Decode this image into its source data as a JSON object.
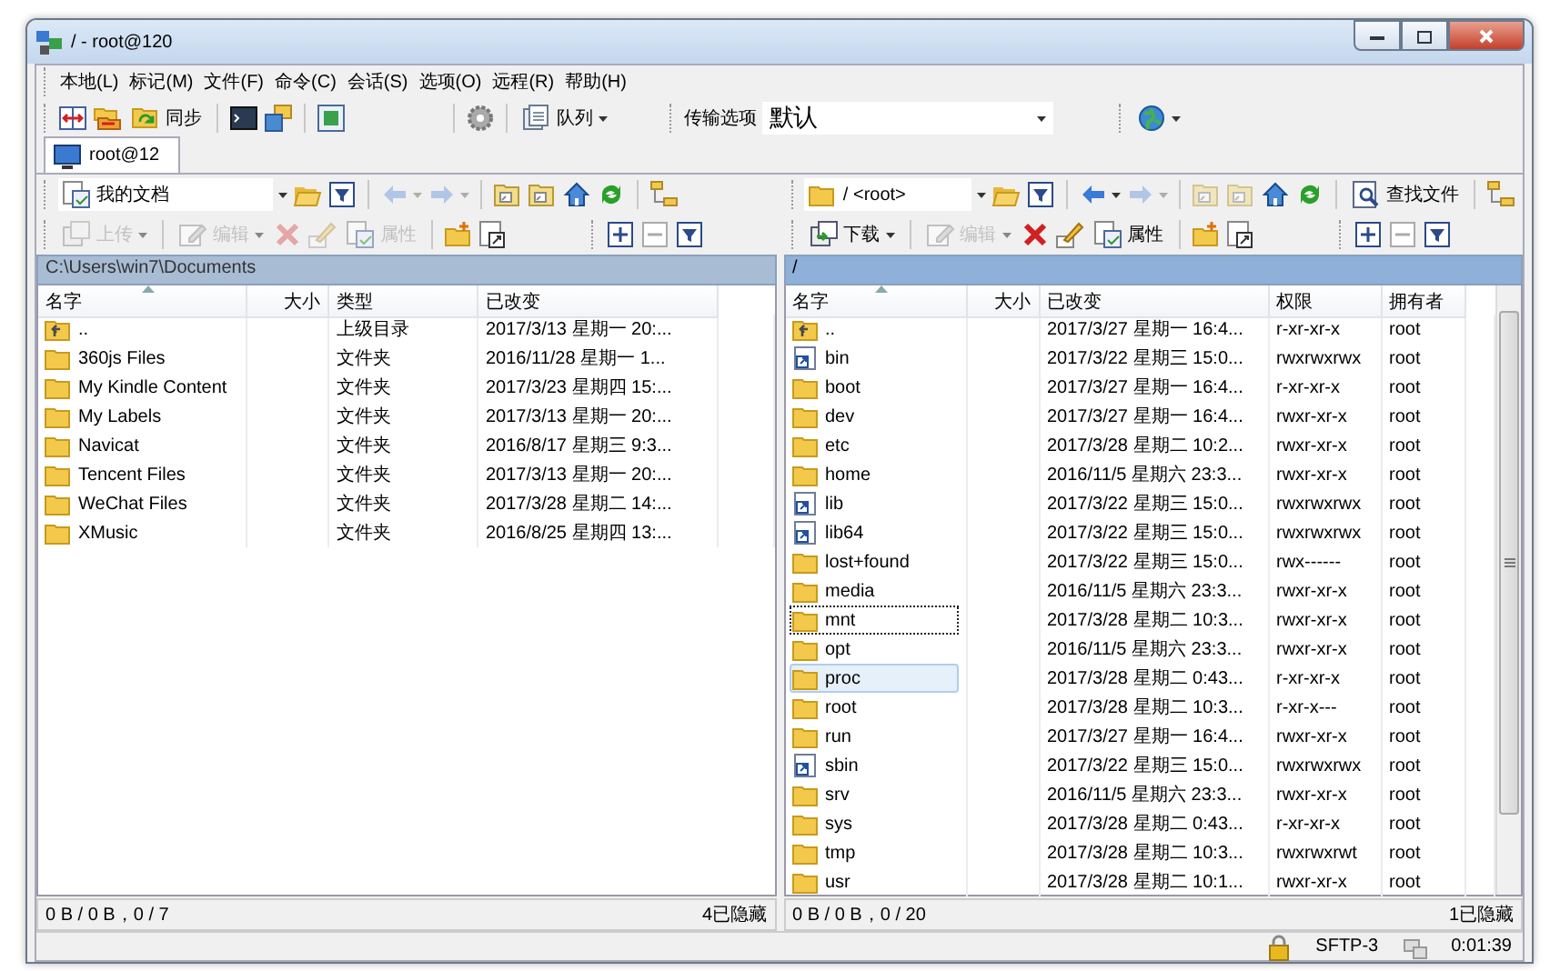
{
  "window": {
    "title": "/ - root@120"
  },
  "menu": [
    "本地(L)",
    "标记(M)",
    "文件(F)",
    "命令(C)",
    "会话(S)",
    "选项(O)",
    "远程(R)",
    "帮助(H)"
  ],
  "toolbar": {
    "sync_button": "同步",
    "queue_button": "队列",
    "transfer_label": "传输选项",
    "transfer_value": "默认"
  },
  "tabs": [
    {
      "label": "root@12",
      "selected": true
    }
  ],
  "left": {
    "location": "我的文档",
    "commands": [
      {
        "label": "上传",
        "disabled": true
      },
      {
        "label": "编辑",
        "disabled": true
      },
      {
        "label": "属性",
        "disabled": true
      }
    ],
    "path": "C:\\Users\\win7\\Documents",
    "columns": [
      {
        "label": "名字",
        "sorted": true
      },
      {
        "label": "大小",
        "sorted": false
      },
      {
        "label": "类型",
        "sorted": false
      },
      {
        "label": "已改变",
        "sorted": false
      }
    ],
    "rows": [
      {
        "kind": "parent",
        "name": "..",
        "type": "上级目录",
        "modified": "2017/3/13 星期一  20:...",
        "selected": false,
        "focused": false
      },
      {
        "kind": "folder",
        "name": "360js Files",
        "type": "文件夹",
        "modified": "2016/11/28 星期一  1...",
        "selected": false,
        "focused": false
      },
      {
        "kind": "folder",
        "name": "My Kindle Content",
        "type": "文件夹",
        "modified": "2017/3/23 星期四  15:...",
        "selected": false,
        "focused": false
      },
      {
        "kind": "folder",
        "name": "My Labels",
        "type": "文件夹",
        "modified": "2017/3/13 星期一  20:...",
        "selected": false,
        "focused": false
      },
      {
        "kind": "folder",
        "name": "Navicat",
        "type": "文件夹",
        "modified": "2016/8/17 星期三  9:3...",
        "selected": false,
        "focused": false
      },
      {
        "kind": "folder",
        "name": "Tencent Files",
        "type": "文件夹",
        "modified": "2017/3/13 星期一  20:...",
        "selected": false,
        "focused": false
      },
      {
        "kind": "folder",
        "name": "WeChat Files",
        "type": "文件夹",
        "modified": "2017/3/28 星期二  14:...",
        "selected": false,
        "focused": false
      },
      {
        "kind": "folder",
        "name": "XMusic",
        "type": "文件夹",
        "modified": "2016/8/25 星期四  13:...",
        "selected": false,
        "focused": false
      }
    ],
    "status": "0 B / 0 B，0 / 7",
    "hidden": "4已隐藏"
  },
  "right": {
    "location": "/ <root>",
    "find_button": "查找文件",
    "commands": [
      {
        "label": "下载",
        "disabled": false
      },
      {
        "label": "编辑",
        "disabled": true
      },
      {
        "label": "属性",
        "disabled": false
      }
    ],
    "path": "/",
    "columns": [
      {
        "label": "名字",
        "sorted": true
      },
      {
        "label": "大小",
        "sorted": false
      },
      {
        "label": "已改变",
        "sorted": false
      },
      {
        "label": "权限",
        "sorted": false
      },
      {
        "label": "拥有者",
        "sorted": false
      }
    ],
    "rows": [
      {
        "kind": "parent",
        "name": "..",
        "modified": "2017/3/27 星期一  16:4...",
        "permissions": "r-xr-xr-x",
        "owner": "root",
        "selected": false,
        "focused": false
      },
      {
        "kind": "link",
        "name": "bin",
        "modified": "2017/3/22 星期三  15:0...",
        "permissions": "rwxrwxrwx",
        "owner": "root",
        "selected": false,
        "focused": false
      },
      {
        "kind": "folder",
        "name": "boot",
        "modified": "2017/3/27 星期一  16:4...",
        "permissions": "r-xr-xr-x",
        "owner": "root",
        "selected": false,
        "focused": false
      },
      {
        "kind": "folder",
        "name": "dev",
        "modified": "2017/3/27 星期一  16:4...",
        "permissions": "rwxr-xr-x",
        "owner": "root",
        "selected": false,
        "focused": false
      },
      {
        "kind": "folder",
        "name": "etc",
        "modified": "2017/3/28 星期二  10:2...",
        "permissions": "rwxr-xr-x",
        "owner": "root",
        "selected": false,
        "focused": false
      },
      {
        "kind": "folder",
        "name": "home",
        "modified": "2016/11/5 星期六  23:3...",
        "permissions": "rwxr-xr-x",
        "owner": "root",
        "selected": false,
        "focused": false
      },
      {
        "kind": "link",
        "name": "lib",
        "modified": "2017/3/22 星期三  15:0...",
        "permissions": "rwxrwxrwx",
        "owner": "root",
        "selected": false,
        "focused": false
      },
      {
        "kind": "link",
        "name": "lib64",
        "modified": "2017/3/22 星期三  15:0...",
        "permissions": "rwxrwxrwx",
        "owner": "root",
        "selected": false,
        "focused": false
      },
      {
        "kind": "folder",
        "name": "lost+found",
        "modified": "2017/3/22 星期三  15:0...",
        "permissions": "rwx------",
        "owner": "root",
        "selected": false,
        "focused": false
      },
      {
        "kind": "folder",
        "name": "media",
        "modified": "2016/11/5 星期六  23:3...",
        "permissions": "rwxr-xr-x",
        "owner": "root",
        "selected": false,
        "focused": false
      },
      {
        "kind": "folder",
        "name": "mnt",
        "modified": "2017/3/28 星期二  10:3...",
        "permissions": "rwxr-xr-x",
        "owner": "root",
        "selected": false,
        "focused": true
      },
      {
        "kind": "folder",
        "name": "opt",
        "modified": "2016/11/5 星期六  23:3...",
        "permissions": "rwxr-xr-x",
        "owner": "root",
        "selected": false,
        "focused": false
      },
      {
        "kind": "folder",
        "name": "proc",
        "modified": "2017/3/28 星期二  0:43...",
        "permissions": "r-xr-xr-x",
        "owner": "root",
        "selected": true,
        "focused": false
      },
      {
        "kind": "folder",
        "name": "root",
        "modified": "2017/3/28 星期二  10:3...",
        "permissions": "r-xr-x---",
        "owner": "root",
        "selected": false,
        "focused": false
      },
      {
        "kind": "folder",
        "name": "run",
        "modified": "2017/3/27 星期一  16:4...",
        "permissions": "rwxr-xr-x",
        "owner": "root",
        "selected": false,
        "focused": false
      },
      {
        "kind": "link",
        "name": "sbin",
        "modified": "2017/3/22 星期三  15:0...",
        "permissions": "rwxrwxrwx",
        "owner": "root",
        "selected": false,
        "focused": false
      },
      {
        "kind": "folder",
        "name": "srv",
        "modified": "2016/11/5 星期六  23:3...",
        "permissions": "rwxr-xr-x",
        "owner": "root",
        "selected": false,
        "focused": false
      },
      {
        "kind": "folder",
        "name": "sys",
        "modified": "2017/3/28 星期二  0:43...",
        "permissions": "r-xr-xr-x",
        "owner": "root",
        "selected": false,
        "focused": false
      },
      {
        "kind": "folder",
        "name": "tmp",
        "modified": "2017/3/28 星期二  10:3...",
        "permissions": "rwxrwxrwt",
        "owner": "root",
        "selected": false,
        "focused": false
      },
      {
        "kind": "folder",
        "name": "usr",
        "modified": "2017/3/28 星期二  10:1...",
        "permissions": "rwxr-xr-x",
        "owner": "root",
        "selected": false,
        "focused": false
      }
    ],
    "status": "0 B / 0 B，0 / 20",
    "hidden": "1已隐藏"
  },
  "status_bar": {
    "protocol": "SFTP-3",
    "time": "0:01:39"
  }
}
